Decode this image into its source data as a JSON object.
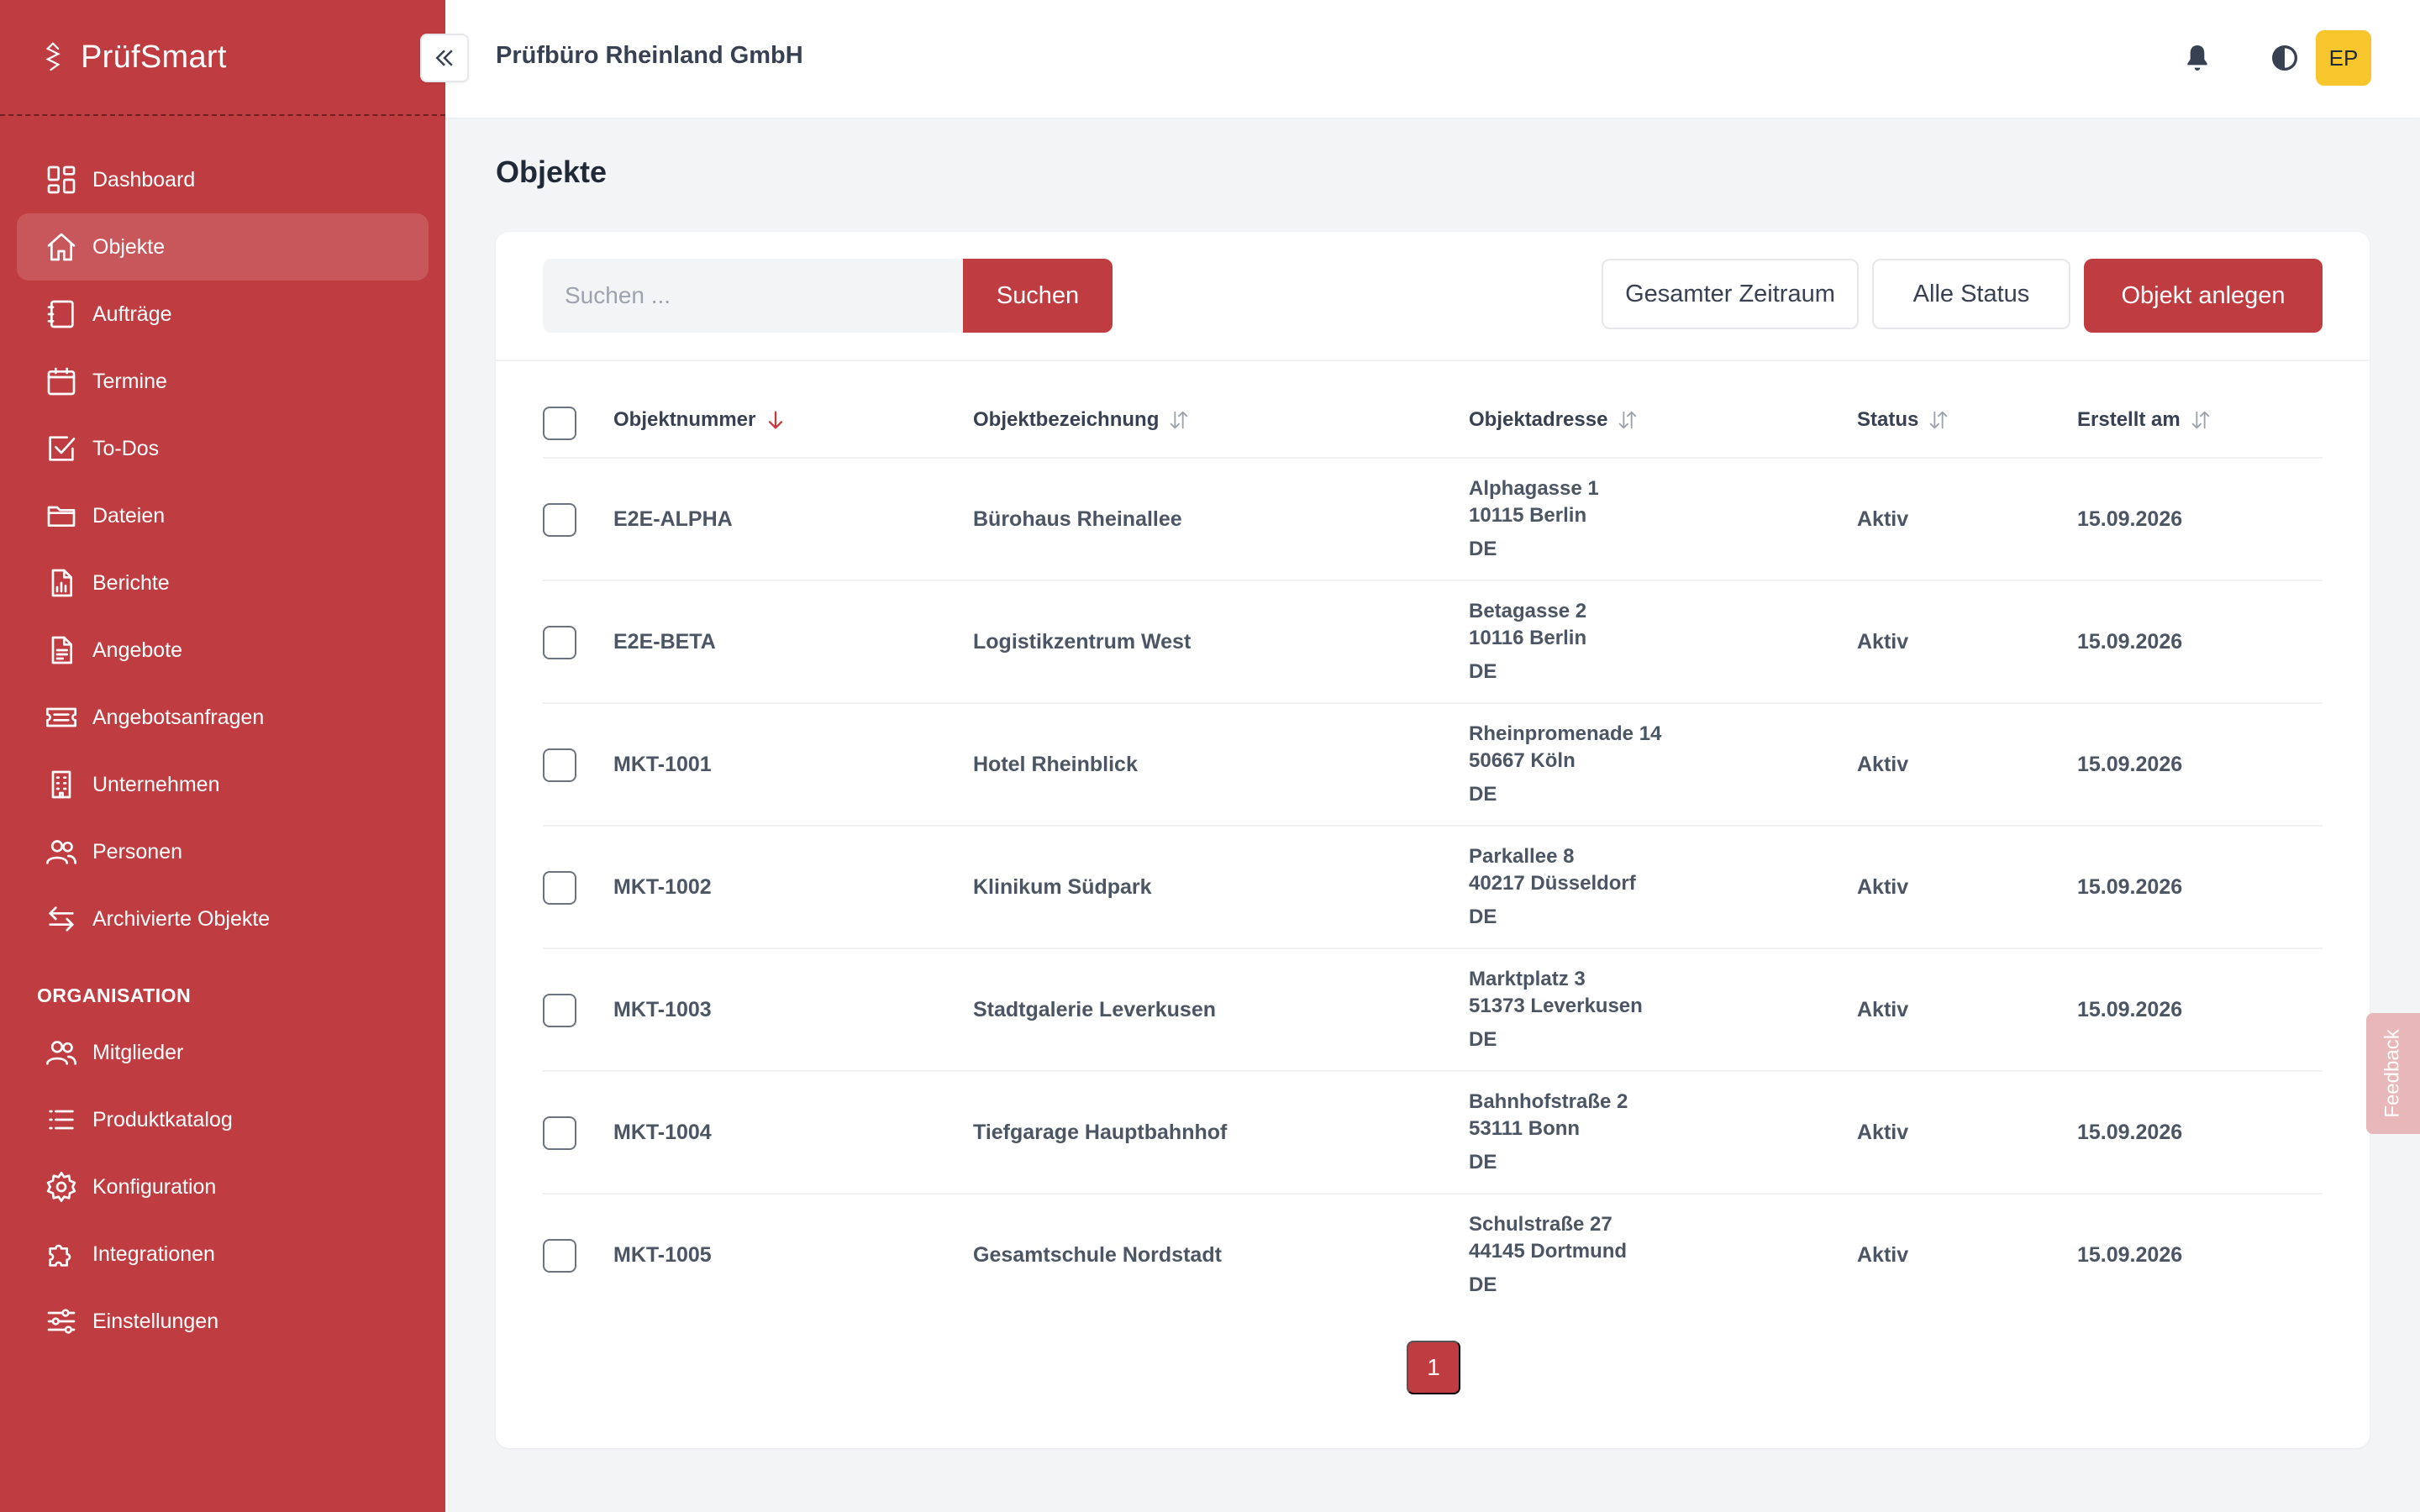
{
  "brand": {
    "name": "PrüfSmart"
  },
  "header": {
    "org_name": "Prüfbüro Rheinland GmbH",
    "avatar_initials": "EP"
  },
  "sidebar": {
    "items": [
      {
        "label": "Dashboard",
        "icon": "dashboard-icon"
      },
      {
        "label": "Objekte",
        "icon": "home-icon",
        "active": true
      },
      {
        "label": "Aufträge",
        "icon": "clipboard-icon"
      },
      {
        "label": "Termine",
        "icon": "calendar-icon"
      },
      {
        "label": "To-Dos",
        "icon": "checkbox-icon"
      },
      {
        "label": "Dateien",
        "icon": "folder-icon"
      },
      {
        "label": "Berichte",
        "icon": "report-icon"
      },
      {
        "label": "Angebote",
        "icon": "document-icon"
      },
      {
        "label": "Angebotsanfragen",
        "icon": "ticket-icon"
      },
      {
        "label": "Unternehmen",
        "icon": "building-icon"
      },
      {
        "label": "Personen",
        "icon": "users-icon"
      },
      {
        "label": "Archivierte Objekte",
        "icon": "arrows-icon"
      }
    ],
    "section_title": "ORGANISATION",
    "org_items": [
      {
        "label": "Mitglieder",
        "icon": "users-icon"
      },
      {
        "label": "Produktkatalog",
        "icon": "list-icon"
      },
      {
        "label": "Konfiguration",
        "icon": "gear-icon"
      },
      {
        "label": "Integrationen",
        "icon": "puzzle-icon"
      },
      {
        "label": "Einstellungen",
        "icon": "sliders-icon"
      }
    ]
  },
  "page": {
    "title": "Objekte"
  },
  "toolbar": {
    "search_placeholder": "Suchen ...",
    "search_label": "Suchen",
    "period_filter": "Gesamter Zeitraum",
    "status_filter": "Alle Status",
    "create_label": "Objekt anlegen"
  },
  "table": {
    "headers": {
      "number": "Objektnummer",
      "name": "Objektbezeichnung",
      "address": "Objektadresse",
      "status": "Status",
      "created": "Erstellt am"
    },
    "rows": [
      {
        "number": "E2E-ALPHA",
        "name": "Bürohaus Rheinallee",
        "street": "Alphagasse 1",
        "city": "10115 Berlin",
        "country": "DE",
        "status": "Aktiv",
        "created": "15.09.2026"
      },
      {
        "number": "E2E-BETA",
        "name": "Logistikzentrum West",
        "street": "Betagasse 2",
        "city": "10116 Berlin",
        "country": "DE",
        "status": "Aktiv",
        "created": "15.09.2026"
      },
      {
        "number": "MKT-1001",
        "name": "Hotel Rheinblick",
        "street": "Rheinpromenade 14",
        "city": "50667 Köln",
        "country": "DE",
        "status": "Aktiv",
        "created": "15.09.2026"
      },
      {
        "number": "MKT-1002",
        "name": "Klinikum Südpark",
        "street": "Parkallee 8",
        "city": "40217 Düsseldorf",
        "country": "DE",
        "status": "Aktiv",
        "created": "15.09.2026"
      },
      {
        "number": "MKT-1003",
        "name": "Stadtgalerie Leverkusen",
        "street": "Marktplatz 3",
        "city": "51373 Leverkusen",
        "country": "DE",
        "status": "Aktiv",
        "created": "15.09.2026"
      },
      {
        "number": "MKT-1004",
        "name": "Tiefgarage Hauptbahnhof",
        "street": "Bahnhofstraße 2",
        "city": "53111 Bonn",
        "country": "DE",
        "status": "Aktiv",
        "created": "15.09.2026"
      },
      {
        "number": "MKT-1005",
        "name": "Gesamtschule Nordstadt",
        "street": "Schulstraße 27",
        "city": "44145 Dortmund",
        "country": "DE",
        "status": "Aktiv",
        "created": "15.09.2026"
      }
    ]
  },
  "pagination": {
    "current": "1"
  },
  "feedback": {
    "label": "Feedback"
  },
  "colors": {
    "brand": "#bf3c40",
    "avatar": "#f7c52c",
    "page_bg": "#f3f4f6"
  }
}
